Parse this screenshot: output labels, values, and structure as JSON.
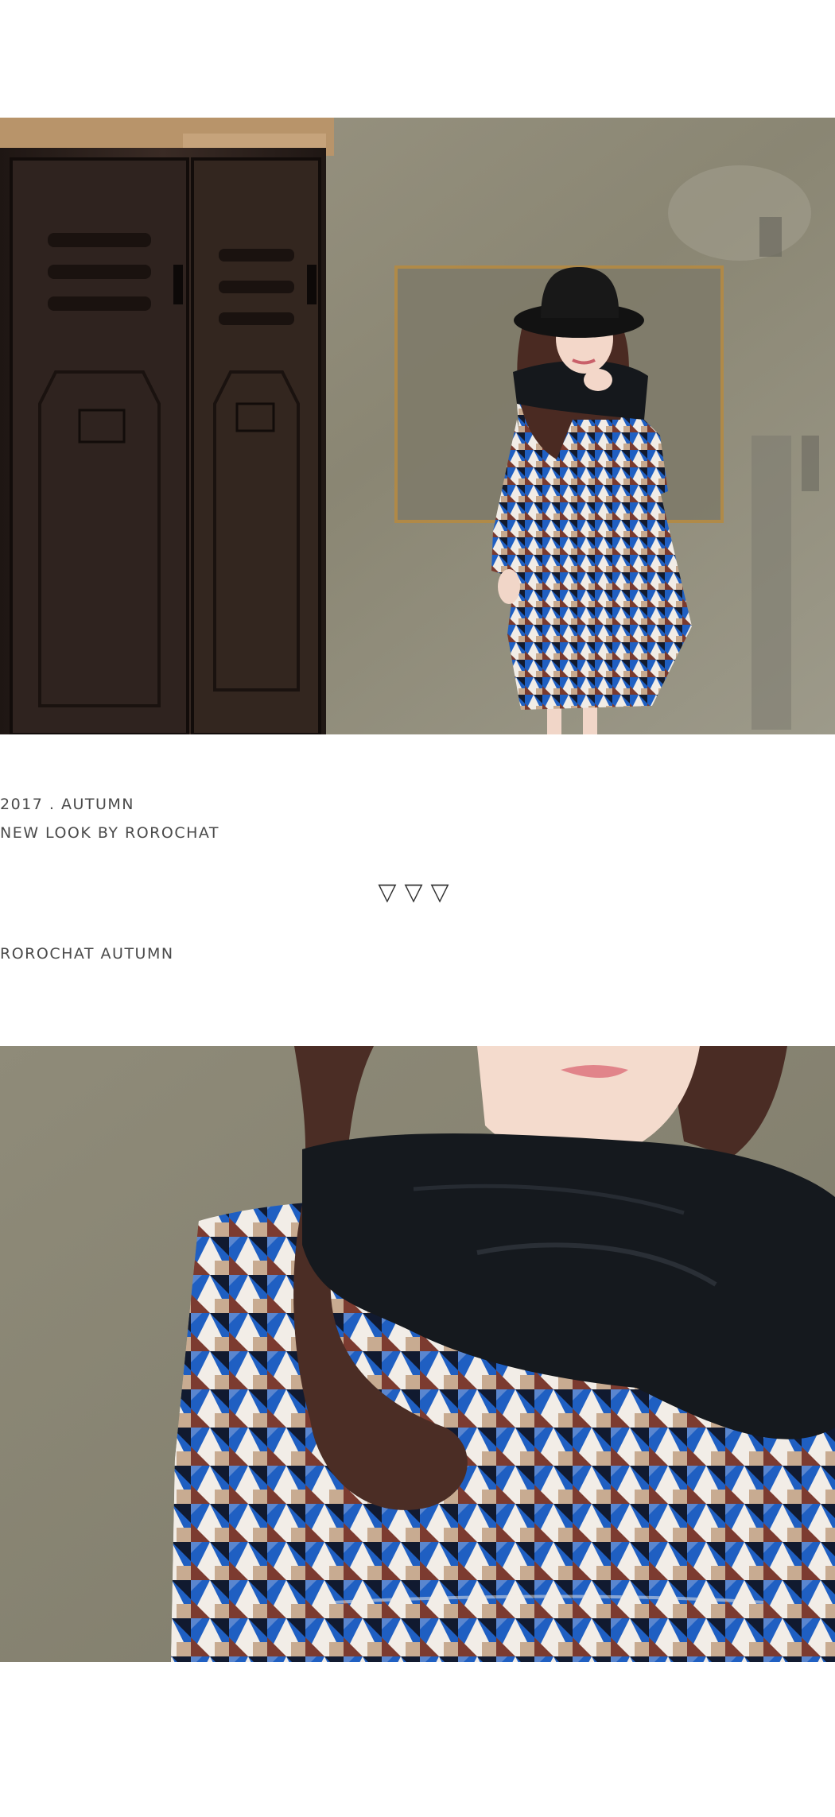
{
  "photos": {
    "top": {
      "subject": "girl in black hat and scarf wearing blue geometric print dress beside dark metal lockers"
    },
    "bottom": {
      "subject": "close-up of girl with wavy hair, black scarf and blue geometric print dress"
    }
  },
  "caption": {
    "year_line": "2017 . AUTUMN",
    "lookbook_line": "NEW LOOK  BY ROROCHAT",
    "triangles": "▽▽▽",
    "collection_line": "ROROCHAT AUTUMN"
  },
  "colors": {
    "wall": "#8d8a79",
    "locker": "#2b201c",
    "dress_blue": "#1f5fc2",
    "scarf": "#15181c"
  }
}
